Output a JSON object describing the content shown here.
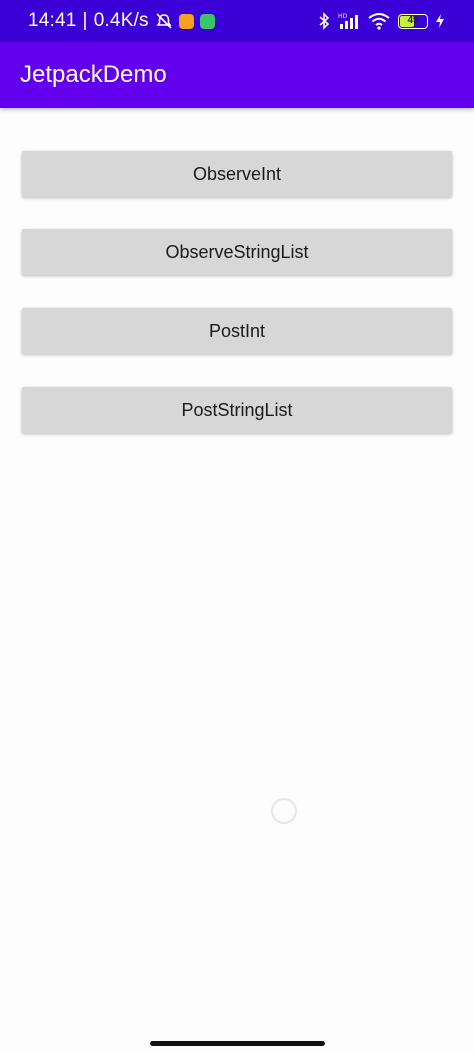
{
  "status_bar": {
    "time": "14:41",
    "separator": "|",
    "net_speed": "0.4K/s",
    "battery_level": "49",
    "icons": [
      "alarm-off-icon",
      "app-notification-icon",
      "app-notification-icon",
      "bluetooth-icon",
      "hd-signal-icon",
      "wifi-icon",
      "battery-icon",
      "charging-icon"
    ],
    "background_color": "#3a00d6"
  },
  "app_bar": {
    "title": "JetpackDemo",
    "background_color": "#6200ee"
  },
  "buttons": [
    {
      "label": "ObserveInt"
    },
    {
      "label": "ObserveStringList"
    },
    {
      "label": "PostInt"
    },
    {
      "label": "PostStringList"
    }
  ],
  "colors": {
    "button_background": "#d7d7d7",
    "page_background": "#fdfdfd"
  }
}
